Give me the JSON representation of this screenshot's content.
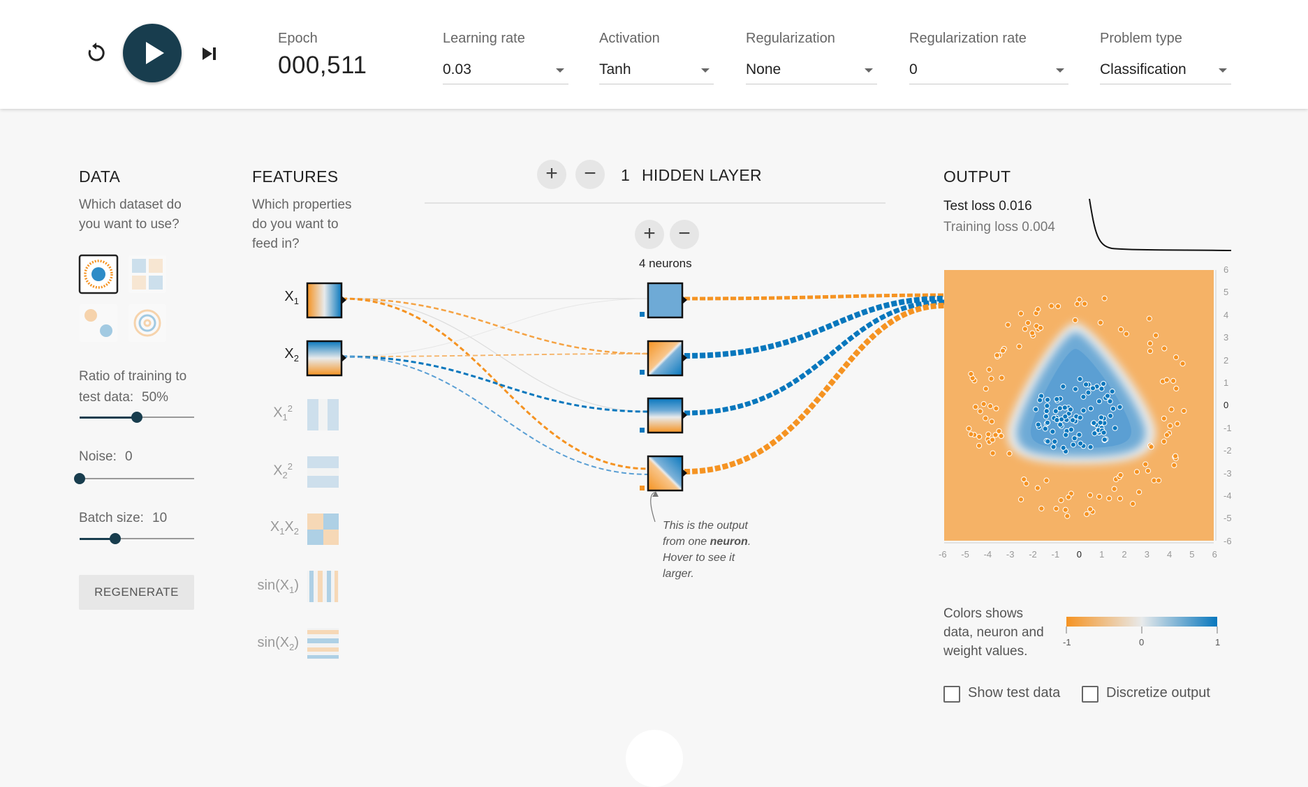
{
  "controls": {
    "reset_icon": "reset-icon",
    "play_icon": "play-icon",
    "step_icon": "step-icon",
    "epoch_label": "Epoch",
    "epoch_value": "000,511",
    "learning_rate": {
      "label": "Learning rate",
      "value": "0.03"
    },
    "activation": {
      "label": "Activation",
      "value": "Tanh"
    },
    "regularization": {
      "label": "Regularization",
      "value": "None"
    },
    "regularization_rate": {
      "label": "Regularization rate",
      "value": "0"
    },
    "problem_type": {
      "label": "Problem type",
      "value": "Classification"
    }
  },
  "data_panel": {
    "title": "DATA",
    "subtitle_1": "Which dataset do",
    "subtitle_2": "you want to use?",
    "ratio_label": "Ratio of training to",
    "ratio_label_2": "test data:",
    "ratio_value": "50%",
    "ratio_fraction": 0.5,
    "noise_label": "Noise:",
    "noise_value": "0",
    "noise_fraction": 0.0,
    "batch_label": "Batch size:",
    "batch_value": "10",
    "batch_fraction": 0.31,
    "regenerate_label": "REGENERATE"
  },
  "features_panel": {
    "title": "FEATURES",
    "subtitle_1": "Which properties",
    "subtitle_2": "do you want to",
    "subtitle_3": "feed in?",
    "features": [
      {
        "base": "X",
        "sub": "1",
        "sup": ""
      },
      {
        "base": "X",
        "sub": "2",
        "sup": ""
      },
      {
        "base": "X",
        "sub": "1",
        "sup": "2"
      },
      {
        "base": "X",
        "sub": "2",
        "sup": "2"
      },
      {
        "base": "X",
        "sub": "1",
        "base2": "X",
        "sub2": "2"
      },
      {
        "base": "sin(X",
        "sub": "1",
        "end": ")"
      },
      {
        "base": "sin(X",
        "sub": "2",
        "end": ")"
      }
    ]
  },
  "hidden": {
    "layer_count": "1",
    "layer_label": "HIDDEN LAYER",
    "neurons_label": "4 neurons",
    "plus": "+",
    "minus": "−",
    "callout_1": "This is the output",
    "callout_2a": "from one ",
    "callout_2b": "neuron",
    "callout_2c": ".",
    "callout_3": "Hover to see it",
    "callout_4": "larger."
  },
  "output": {
    "title": "OUTPUT",
    "test_loss": "Test loss 0.016",
    "training_loss": "Training loss 0.004",
    "x_ticks": [
      "-6",
      "-5",
      "-4",
      "-3",
      "-2",
      "-1",
      "0",
      "1",
      "2",
      "3",
      "4",
      "5",
      "6"
    ],
    "y_ticks": [
      "6",
      "5",
      "4",
      "3",
      "2",
      "1",
      "0",
      "-1",
      "-2",
      "-3",
      "-4",
      "-5",
      "-6"
    ],
    "legend_1": "Colors shows",
    "legend_2": "data, neuron and",
    "legend_3": "weight values.",
    "legend_min": "-1",
    "legend_mid": "0",
    "legend_max": "1",
    "show_test_label": "Show test data",
    "discretize_label": "Discretize output"
  },
  "colors": {
    "orange": "#f59322",
    "blue": "#0877bd",
    "dark": "#183d4e"
  }
}
